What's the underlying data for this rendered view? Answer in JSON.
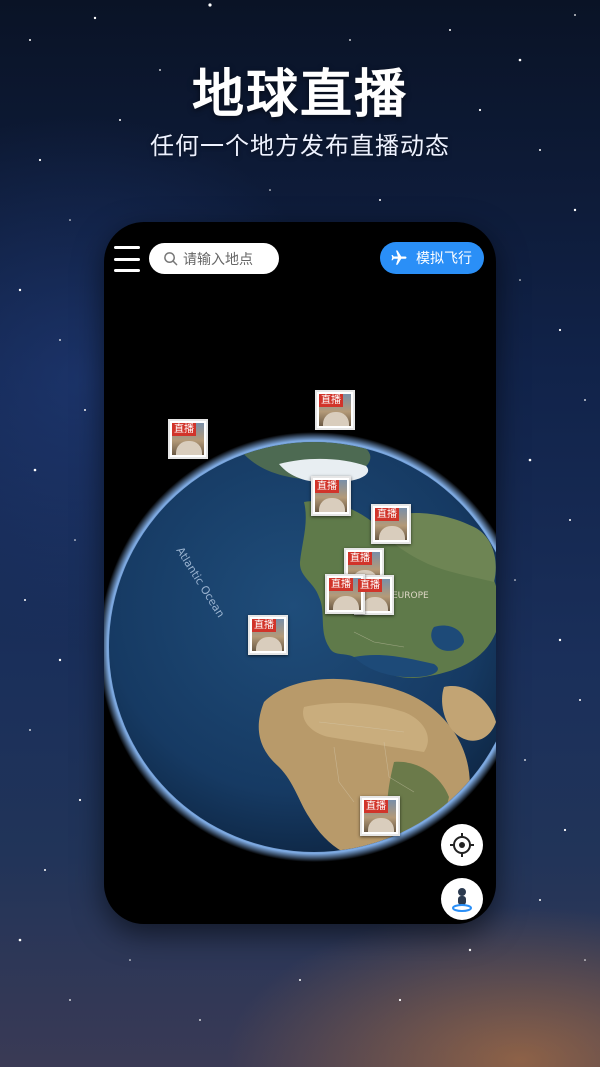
{
  "promo": {
    "title": "地球直播",
    "subtitle": "任何一个地方发布直播动态"
  },
  "toolbar": {
    "search_placeholder": "请输入地点",
    "fly_button_label": "模拟飞行"
  },
  "map": {
    "labels": {
      "atlantic_ocean": "Atlantic Ocean",
      "europe": "EUROPE"
    },
    "live_pins": [
      {
        "badge": "直播"
      },
      {
        "badge": "直播"
      },
      {
        "badge": "直播"
      },
      {
        "badge": "直播"
      },
      {
        "badge": "直播"
      },
      {
        "badge": "直播"
      },
      {
        "badge": "直播"
      },
      {
        "badge": "直播"
      },
      {
        "badge": "直播"
      }
    ]
  },
  "icons": {
    "menu": "menu-icon",
    "search": "search-icon",
    "fly": "airplane-icon",
    "locate": "crosshair-icon",
    "street_view": "person-icon"
  },
  "colors": {
    "accent": "#2a8ff7",
    "live_badge": "#d1342a"
  }
}
